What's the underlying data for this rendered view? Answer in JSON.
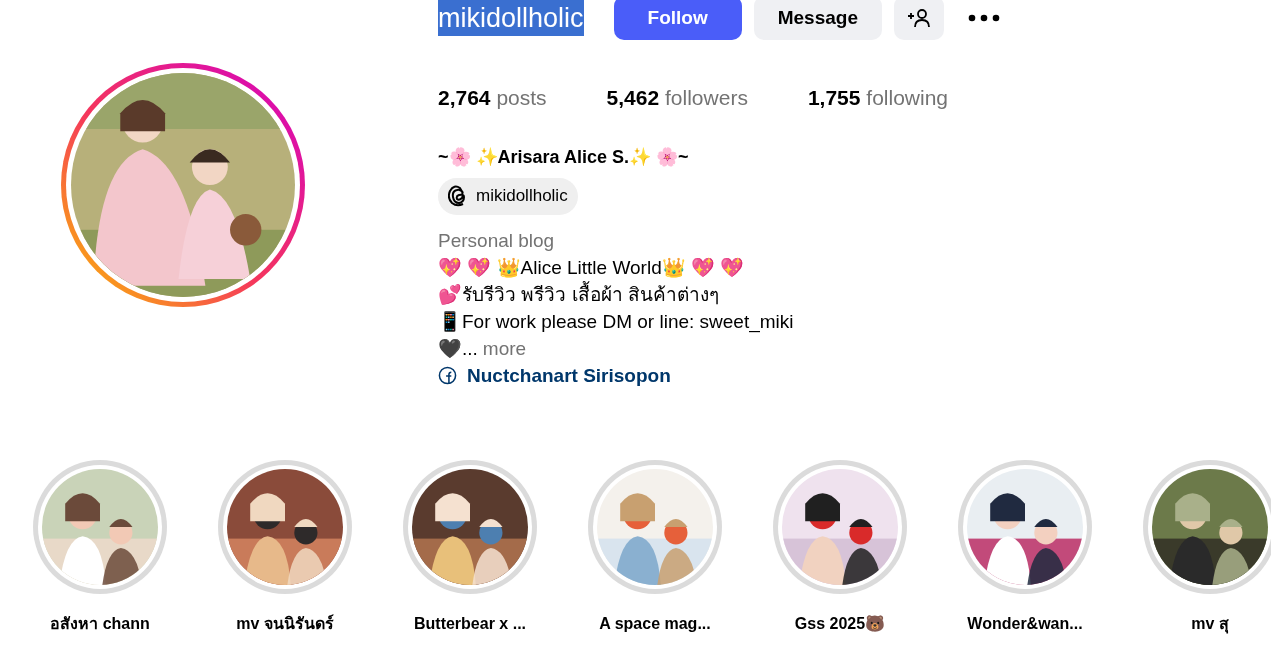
{
  "profile": {
    "username": "mikidollholic",
    "username_highlighted": true,
    "buttons": [
      {
        "kind": "primary",
        "label": "Follow"
      },
      {
        "kind": "secondary",
        "label": "Message"
      },
      {
        "kind": "icon"
      },
      {
        "kind": "more"
      }
    ],
    "stats": [
      {
        "value": "2,764",
        "label": "posts"
      },
      {
        "value": "5,462",
        "label": "followers"
      },
      {
        "value": "1,755",
        "label": "following"
      }
    ],
    "display_name": "~🌸 ✨Arisara Alice S.✨ 🌸~",
    "threads_handle": "mikidollholic",
    "category": "Personal blog",
    "bio_lines": [
      "💖 💖 👑Alice Little World👑 💖 💖",
      "💕รับรีวิว พรีวิว เสื้อผ้า สินค้าต่างๆ",
      "📱For work please DM or line: sweet_miki"
    ],
    "bio_tail": "🖤...",
    "more": "more",
    "link": "Nuctchanart Sirisopon",
    "has_story": true
  },
  "highlights": [
    {
      "label": "อสังหา chann"
    },
    {
      "label": "mv จนนิรันดร์"
    },
    {
      "label": "Butterbear x ..."
    },
    {
      "label": "A space mag..."
    },
    {
      "label": "Gss 2025🐻"
    },
    {
      "label": "Wonder&wan..."
    },
    {
      "label": "mv สุ"
    }
  ]
}
